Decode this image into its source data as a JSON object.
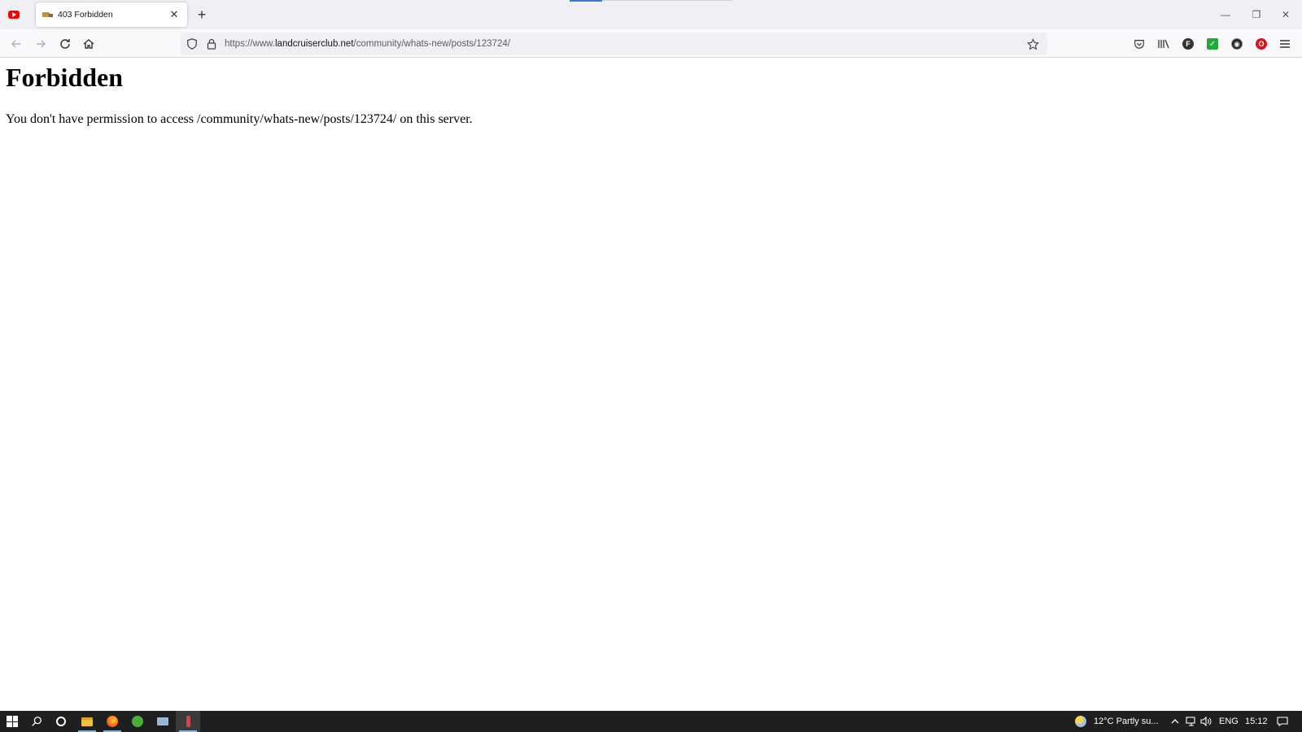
{
  "browser": {
    "tab": {
      "title": "403 Forbidden",
      "close_glyph": "✕"
    },
    "new_tab_glyph": "+",
    "window_controls": {
      "minimize": "—",
      "restore": "❐",
      "close": "✕"
    },
    "url": {
      "scheme": "https://www.",
      "host": "landcruiserclub.net",
      "path": "/community/whats-new/posts/123724/"
    },
    "toolbar_icons": [
      "pocket-icon",
      "library-icon",
      "extension-f-icon",
      "extension-check-icon",
      "extension-dark-icon",
      "opera-icon",
      "menu-icon"
    ]
  },
  "page": {
    "heading": "Forbidden",
    "message": "You don't have permission to access /community/whats-new/posts/123724/ on this server."
  },
  "taskbar": {
    "weather": "12°C  Partly su...",
    "language": "ENG",
    "time": "15:12"
  },
  "colors": {
    "tab_strip": "#f0f0f4",
    "nav_bar": "#f9f9fb",
    "taskbar": "#1f1f1f",
    "youtube_red": "#ff0000",
    "check_green": "#22a83a"
  }
}
